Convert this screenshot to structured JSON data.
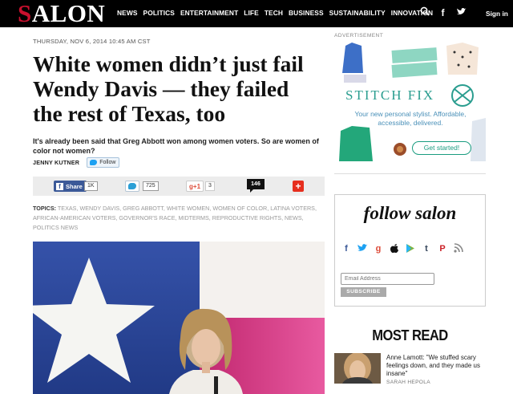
{
  "nav": {
    "logo": "SALON",
    "links": [
      "NEWS",
      "POLITICS",
      "ENTERTAINMENT",
      "LIFE",
      "TECH",
      "BUSINESS",
      "SUSTAINABILITY",
      "INNOVATION"
    ],
    "sign_in": "Sign in"
  },
  "article": {
    "dateline": "THURSDAY, NOV 6, 2014 10:45 AM CST",
    "headline": "White women didn’t just fail Wendy Davis — they failed the rest of Texas, too",
    "dek": "It's already been said that Greg Abbott won among women voters. So are women of color not women?",
    "author": "JENNY KUTNER",
    "follow_label": "Follow"
  },
  "share": {
    "fb_label": "Share",
    "fb_count": "1K",
    "tw_count": "725",
    "gplus_label": "+1",
    "gplus_count": "3",
    "comments": "146",
    "more": "+"
  },
  "topics": {
    "label": "TOPICS:",
    "items": "TEXAS, WENDY DAVIS, GREG ABBOTT, WHITE WOMEN, WOMEN OF COLOR, LATINA VOTERS, AFRICAN-AMERICAN VOTERS, GOVERNOR'S RACE, MIDTERMS, REPRODUCTIVE RIGHTS, NEWS, POLITICS NEWS"
  },
  "ad": {
    "label": "ADVERTISEMENT",
    "brand": "STITCH FIX",
    "tagline": "Your new personal stylist. Affordable, accessible, delivered.",
    "cta": "Get started!"
  },
  "follow_box": {
    "title": "follow salon",
    "email_placeholder": "Email Address",
    "subscribe": "SUBSCRIBE"
  },
  "most_read": {
    "heading": "MOST READ",
    "item_title": "Anne Lamott: \"We stuffed scary feelings down, and they made us insane\"",
    "item_author": "SARAH HEPOLA"
  }
}
